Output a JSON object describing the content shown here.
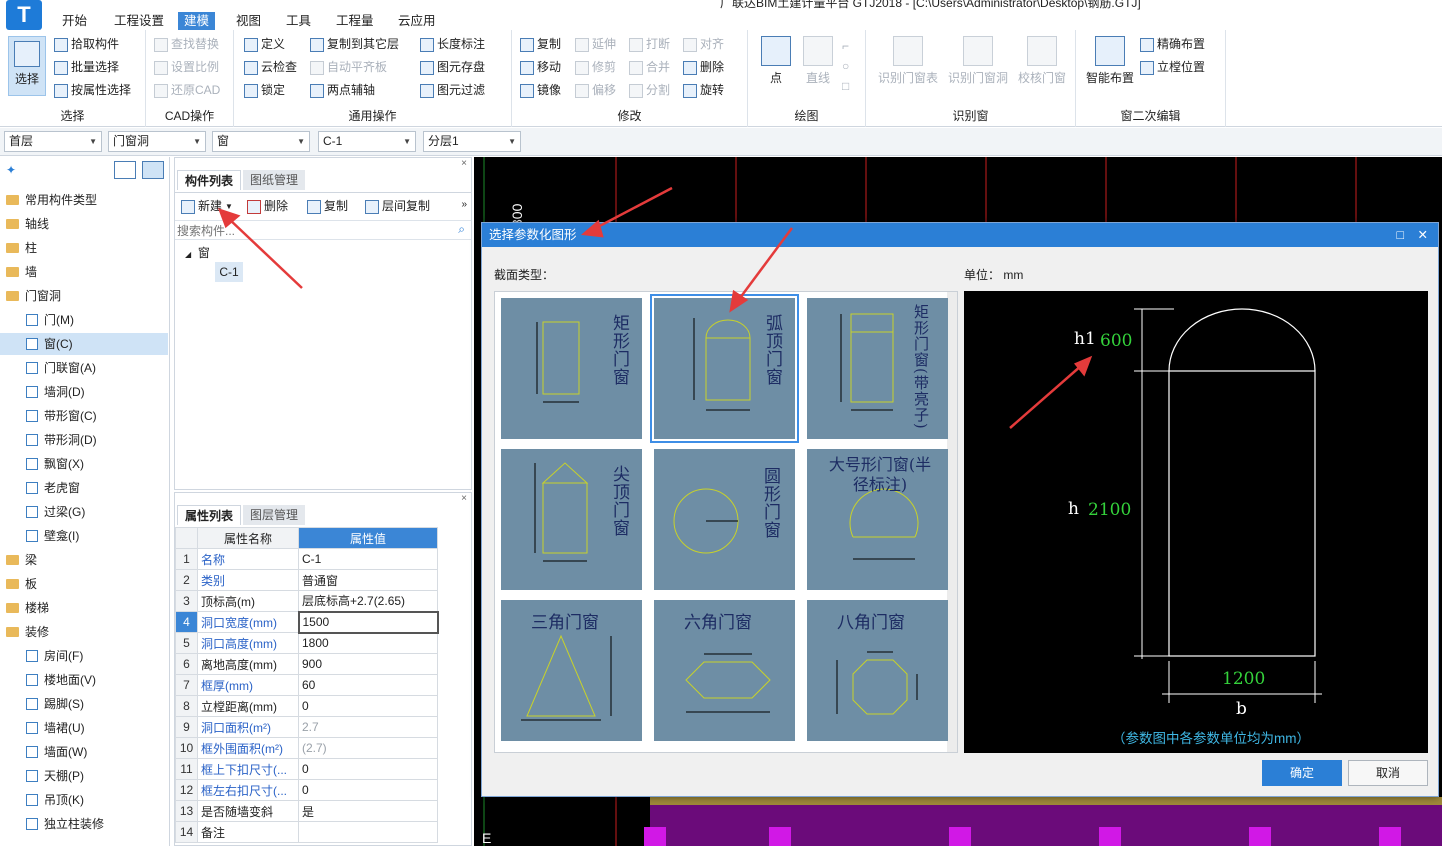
{
  "app": {
    "window_title": "广联达BIM土建计量平台 GTJ2018 - [C:\\Users\\Administrator\\Desktop\\钢筋.GTJ]",
    "logo_letter": "T"
  },
  "menu_tabs": [
    "开始",
    "工程设置",
    "建模",
    "视图",
    "工具",
    "工程量",
    "云应用"
  ],
  "active_tab": "建模",
  "ribbon": {
    "select": {
      "big": "选择",
      "items": [
        "拾取构件",
        "批量选择",
        "按属性选择"
      ],
      "label": "选择"
    },
    "cad": {
      "items": [
        "查找替换",
        "设置比例",
        "还原CAD"
      ],
      "label": "CAD操作"
    },
    "common": {
      "col1": [
        "定义",
        "云检查",
        "锁定"
      ],
      "col2": [
        "复制到其它层",
        "自动平齐板",
        "两点辅轴"
      ],
      "col3": [
        "长度标注",
        "图元存盘",
        "图元过滤"
      ],
      "label": "通用操作"
    },
    "modify": {
      "col1": [
        "复制",
        "移动",
        "镜像"
      ],
      "col2": [
        "延伸",
        "修剪",
        "偏移"
      ],
      "col3": [
        "打断",
        "合并",
        "分割"
      ],
      "col4": [
        "对齐",
        "删除",
        "旋转"
      ],
      "label": "修改"
    },
    "draw": {
      "items": [
        "点",
        "直线"
      ],
      "label": "绘图"
    },
    "recognize": {
      "items": [
        "识别门窗表",
        "识别门窗洞",
        "校核门窗"
      ],
      "label": "识别窗"
    },
    "edit2": {
      "big": "智能布置",
      "items": [
        "精确布置",
        "立樘位置"
      ],
      "label": "窗二次编辑"
    }
  },
  "selectors": [
    "首层",
    "门窗洞",
    "窗",
    "C-1",
    "分层1"
  ],
  "tree": {
    "items": [
      {
        "label": "常用构件类型",
        "type": "folder"
      },
      {
        "label": "轴线",
        "type": "folder"
      },
      {
        "label": "柱",
        "type": "folder"
      },
      {
        "label": "墙",
        "type": "folder"
      },
      {
        "label": "门窗洞",
        "type": "folder-open"
      },
      {
        "label": "门(M)",
        "type": "child"
      },
      {
        "label": "窗(C)",
        "type": "child",
        "selected": true
      },
      {
        "label": "门联窗(A)",
        "type": "child"
      },
      {
        "label": "墙洞(D)",
        "type": "child"
      },
      {
        "label": "带形窗(C)",
        "type": "child"
      },
      {
        "label": "带形洞(D)",
        "type": "child"
      },
      {
        "label": "飘窗(X)",
        "type": "child"
      },
      {
        "label": "老虎窗",
        "type": "child"
      },
      {
        "label": "过梁(G)",
        "type": "child"
      },
      {
        "label": "壁龛(I)",
        "type": "child"
      },
      {
        "label": "梁",
        "type": "folder"
      },
      {
        "label": "板",
        "type": "folder"
      },
      {
        "label": "楼梯",
        "type": "folder"
      },
      {
        "label": "装修",
        "type": "folder-open"
      },
      {
        "label": "房间(F)",
        "type": "child"
      },
      {
        "label": "楼地面(V)",
        "type": "child"
      },
      {
        "label": "踢脚(S)",
        "type": "child"
      },
      {
        "label": "墙裙(U)",
        "type": "child"
      },
      {
        "label": "墙面(W)",
        "type": "child"
      },
      {
        "label": "天棚(P)",
        "type": "child"
      },
      {
        "label": "吊顶(K)",
        "type": "child"
      },
      {
        "label": "独立柱装修",
        "type": "child"
      }
    ]
  },
  "component_panel": {
    "tabs": [
      "构件列表",
      "图纸管理"
    ],
    "toolbar": [
      "新建",
      "删除",
      "复制",
      "层间复制"
    ],
    "search_placeholder": "搜索构件...",
    "group": "窗",
    "item": "C-1"
  },
  "property_panel": {
    "tabs": [
      "属性列表",
      "图层管理"
    ],
    "headers": [
      "属性名称",
      "属性值"
    ],
    "rows": [
      {
        "n": "1",
        "k": "名称",
        "v": "C-1",
        "blue": true
      },
      {
        "n": "2",
        "k": "类别",
        "v": "普通窗",
        "blue": true
      },
      {
        "n": "3",
        "k": "顶标高(m)",
        "v": "层底标高+2.7(2.65)",
        "blue": false
      },
      {
        "n": "4",
        "k": "洞口宽度(mm)",
        "v": "1500",
        "blue": true,
        "hl": true
      },
      {
        "n": "5",
        "k": "洞口高度(mm)",
        "v": "1800",
        "blue": true
      },
      {
        "n": "6",
        "k": "离地高度(mm)",
        "v": "900",
        "blue": false
      },
      {
        "n": "7",
        "k": "框厚(mm)",
        "v": "60",
        "blue": true
      },
      {
        "n": "8",
        "k": "立樘距离(mm)",
        "v": "0",
        "blue": false
      },
      {
        "n": "9",
        "k": "洞口面积(m²)",
        "v": "2.7",
        "blue": true,
        "gray": true
      },
      {
        "n": "10",
        "k": "框外围面积(m²)",
        "v": "(2.7)",
        "blue": true,
        "gray": true
      },
      {
        "n": "11",
        "k": "框上下扣尺寸(...",
        "v": "0",
        "blue": true
      },
      {
        "n": "12",
        "k": "框左右扣尺寸(...",
        "v": "0",
        "blue": true
      },
      {
        "n": "13",
        "k": "是否随墙变斜",
        "v": "是",
        "blue": false
      },
      {
        "n": "14",
        "k": "备注",
        "v": "",
        "blue": false
      }
    ]
  },
  "dialog": {
    "title": "选择参数化图形",
    "section_label": "截面类型：",
    "unit_label": "单位：  mm",
    "shapes": [
      {
        "name": "矩形门窗"
      },
      {
        "name": "弧顶门窗",
        "selected": true
      },
      {
        "name": "矩形门窗(带亮子)"
      },
      {
        "name": "尖顶门窗"
      },
      {
        "name": "圆形门窗"
      },
      {
        "name": "大号形门窗(半径标注)"
      },
      {
        "name": "三角门窗"
      },
      {
        "name": "六角门窗"
      },
      {
        "name": "八角门窗"
      }
    ],
    "preview": {
      "h1_label": "h1",
      "h1_value": "600",
      "h_label": "h",
      "h_value": "2100",
      "b_value": "1200",
      "b_label": "b",
      "note": "（参数图中各参数单位均为mm）"
    },
    "ok_button": "确定",
    "cancel_button": "取消"
  },
  "colors": {
    "accent": "#2b7fd6",
    "green_value": "#34d13b",
    "note": "#3fb7e4",
    "shape_bg": "#6e8ea5"
  }
}
